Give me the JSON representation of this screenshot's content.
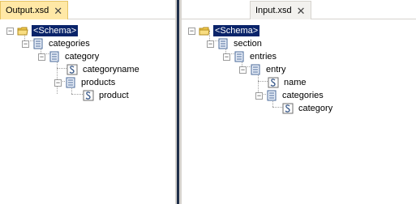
{
  "tabs": {
    "output_tab": {
      "label": "Output.xsd",
      "close_glyph": "✕"
    },
    "input_tab": {
      "label": "Input.xsd",
      "close_glyph": "✕"
    }
  },
  "output_tree": {
    "schema": "<Schema>",
    "categories": "categories",
    "category": "category",
    "categoryname": "categoryname",
    "products": "products",
    "product": "product"
  },
  "input_tree": {
    "schema": "<Schema>",
    "section": "section",
    "entries": "entries",
    "entry": "entry",
    "name": "name",
    "categories": "categories",
    "category": "category"
  },
  "expander_glyph": "−",
  "icons": {
    "schema": "folder-icon",
    "record": "record-icon",
    "field": "field-icon"
  },
  "colors": {
    "selection": "#0a246a",
    "active_tab": "#ffe8a6",
    "splitter": "#1f2f4a"
  }
}
